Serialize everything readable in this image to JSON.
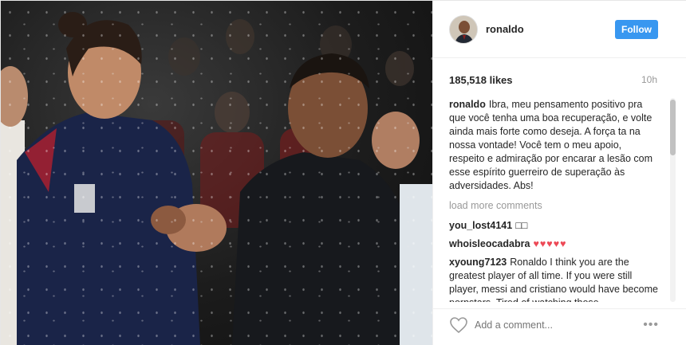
{
  "post": {
    "author": "ronaldo",
    "follow_label": "Follow",
    "likes": "185,518 likes",
    "time_ago": "10h",
    "caption": {
      "user": "ronaldo",
      "text": "Ibra, meu pensamento positivo pra que você tenha uma boa recuperação, e volte ainda mais forte como deseja. A força ta na nossa vontade! Você tem o meu apoio, respeito e admiração por encarar a lesão com esse espírito guerreiro de superação às adversidades. Abs!"
    },
    "load_more": "load more comments",
    "comments": [
      {
        "user": "you_lost4141",
        "text": "□□"
      },
      {
        "user": "whoisleocadabra",
        "text": "♥♥♥♥♥"
      },
      {
        "user": "xyoung7123",
        "text": "Ronaldo I think you are the greatest player of all time. If you were still player, messi and cristiano would have become pornstars. Tired of watching those"
      }
    ],
    "add_comment_placeholder": "Add a comment...",
    "more_options": "•••"
  },
  "icons": {
    "like": "heart-outline-icon",
    "more": "more-options-icon"
  },
  "colors": {
    "follow": "#3897f0",
    "hearts": "#ed4956",
    "muted": "#999999"
  }
}
